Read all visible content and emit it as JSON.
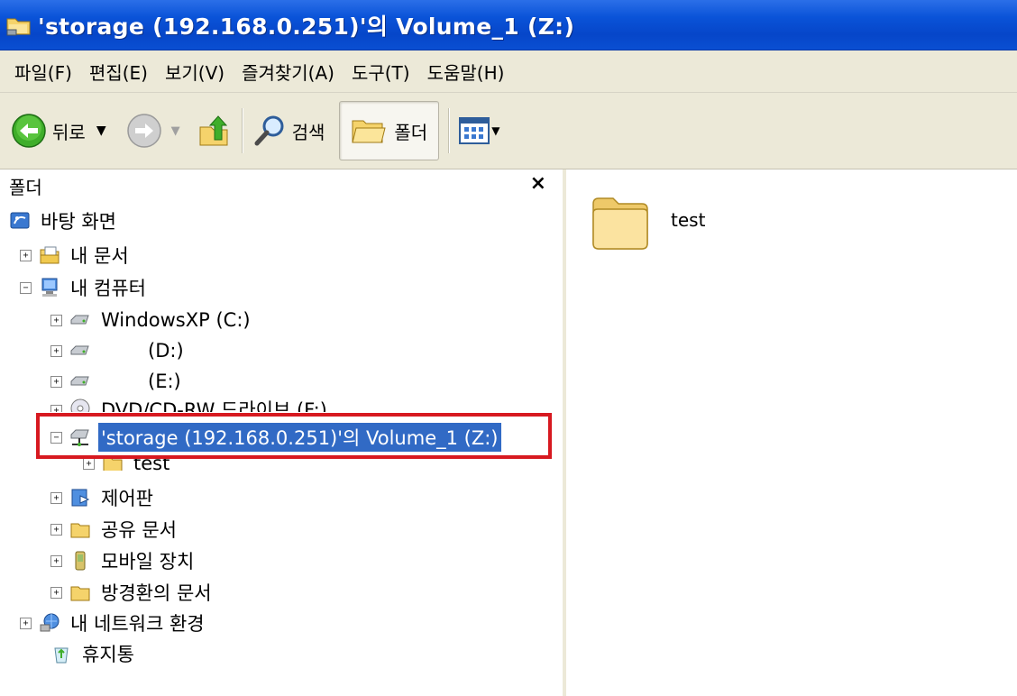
{
  "window": {
    "title": "'storage (192.168.0.251)'의 Volume_1 (Z:)"
  },
  "menu": {
    "items": [
      "파일(F)",
      "편집(E)",
      "보기(V)",
      "즐겨찾기(A)",
      "도구(T)",
      "도움말(H)"
    ]
  },
  "toolbar": {
    "back_label": "뒤로",
    "search_label": "검색",
    "folders_label": "폴더"
  },
  "folders_pane": {
    "title": "폴더",
    "close": "×"
  },
  "tree": {
    "desktop": "바탕 화면",
    "my_documents": "내 문서",
    "my_computer": "내 컴퓨터",
    "drive_c": "WindowsXP (C:)",
    "drive_d": "(D:)",
    "drive_e": "(E:)",
    "drive_f": "DVD/CD-RW 드라이브 (F:)",
    "drive_z": "'storage (192.168.0.251)'의 Volume_1 (Z:)",
    "test": "test",
    "control_panel": "제어판",
    "shared_docs": "공유 문서",
    "mobile_device": "모바일 장치",
    "user_docs": "방경환의 문서",
    "network": "내 네트워크 환경",
    "recycle_bin": "휴지통"
  },
  "content": {
    "items": [
      {
        "name": "test",
        "icon": "folder-icon"
      }
    ]
  },
  "colors": {
    "title_bar": "#0a53d8",
    "selection": "#316ac5",
    "annotation_box": "#d71920",
    "chrome": "#ece9d8"
  }
}
